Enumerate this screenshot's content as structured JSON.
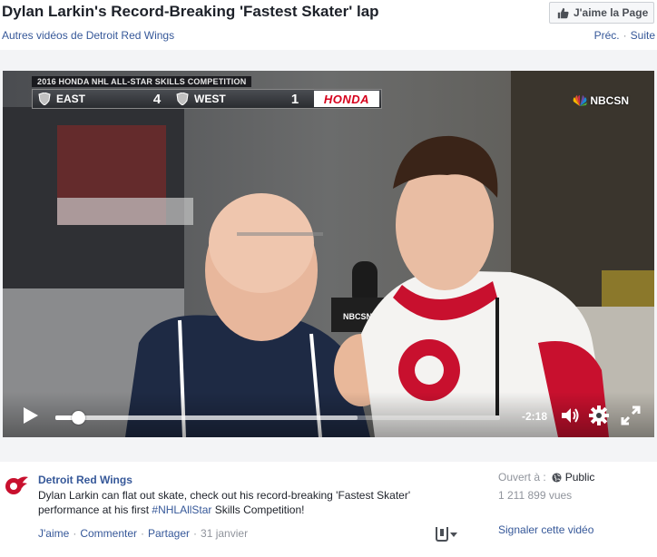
{
  "header": {
    "title": "Dylan Larkin's Record-Breaking 'Fastest Skater' lap",
    "like_page_label": "J'aime la Page",
    "more_videos": "Autres vidéos de Detroit Red Wings",
    "prev": "Préc.",
    "separator": "·",
    "next": "Suite"
  },
  "video": {
    "overlay": {
      "event": "2016 HONDA NHL ALL-STAR SKILLS COMPETITION",
      "team_east": "EAST",
      "score_east": "4",
      "team_west": "WEST",
      "score_west": "1",
      "sponsor": "HONDA",
      "network": "NBCSN",
      "mic_flag": "NBCSN"
    },
    "controls": {
      "time_remaining": "-2:18",
      "played_fraction": 0.05,
      "buffered_fraction": 0.68,
      "play_icon": "play-icon",
      "volume_icon": "volume-icon",
      "settings_icon": "gear-icon",
      "fullscreen_icon": "fullscreen-icon"
    }
  },
  "post": {
    "page_name": "Detroit Red Wings",
    "text_before": "Dylan Larkin can flat out skate, check out his record-breaking 'Fastest Skater' performance at his first ",
    "hashtag": "#NHLAllStar",
    "text_after": " Skills Competition!",
    "actions": {
      "like": "J'aime",
      "comment": "Commenter",
      "share": "Partager",
      "dot": "·",
      "date": "31 janvier"
    },
    "opened_label": "Ouvert à :",
    "audience": "Public",
    "views": "1 211 899 vues",
    "report": "Signaler cette vidéo"
  },
  "colors": {
    "link": "#365899",
    "text": "#1d2129",
    "muted": "#90949c",
    "red_wings_red": "#c8102e"
  }
}
